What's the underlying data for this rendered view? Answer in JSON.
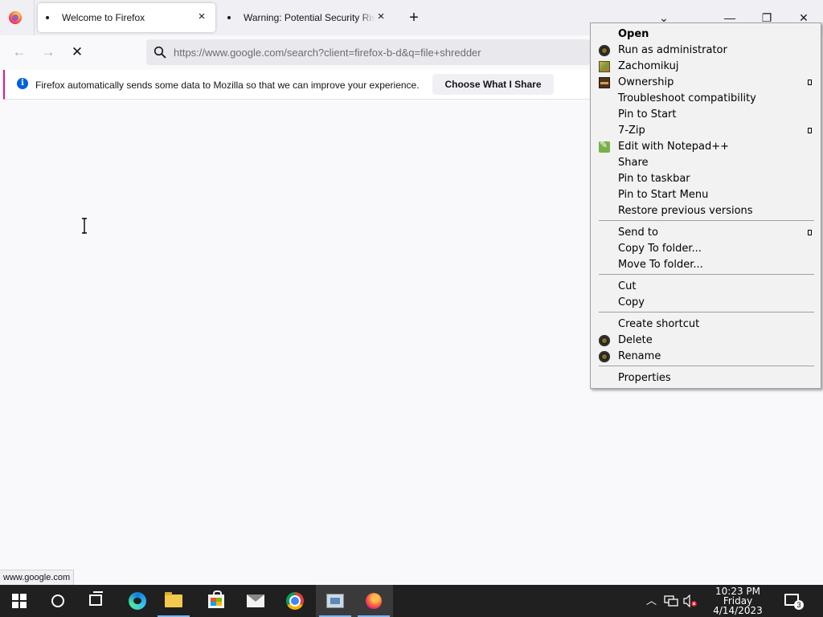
{
  "tabs": [
    {
      "title": "Welcome to Firefox",
      "close": "×"
    },
    {
      "title": "Warning: Potential Security Risk Ahead",
      "close": "×"
    }
  ],
  "window_controls": {
    "list_all_tabs": "⌄",
    "minimize": "—",
    "restore": "❐",
    "close": "✕"
  },
  "nav": {
    "back": "←",
    "forward": "→",
    "stop": "✕",
    "url": "https://www.google.com/search?client=firefox-b-d&q=file+shredder"
  },
  "notification": {
    "text": "Firefox automatically sends some data to Mozilla so that we can improve your experience.",
    "button": "Choose What I Share"
  },
  "status_link": "www.google.com",
  "context_menu": {
    "items": [
      {
        "label": "Open",
        "icon": ""
      },
      {
        "label": "Run as administrator",
        "icon": "shield-gear-icon"
      },
      {
        "label": "Zachomikuj",
        "icon": "zachomikuj-icon"
      },
      {
        "label": "Ownership",
        "icon": "ownership-icon",
        "submenu": true
      },
      {
        "label": "Troubleshoot compatibility",
        "icon": ""
      },
      {
        "label": "Pin to Start",
        "icon": ""
      },
      {
        "label": "7-Zip",
        "icon": "",
        "submenu": true
      },
      {
        "label": "Edit with Notepad++",
        "icon": "notepadpp-icon"
      },
      {
        "label": "Share",
        "icon": ""
      },
      {
        "label": "Pin to taskbar",
        "icon": ""
      },
      {
        "label": "Pin to Start Menu",
        "icon": ""
      },
      {
        "label": "Restore previous versions",
        "icon": ""
      },
      {
        "label": "Send to",
        "icon": "",
        "submenu": true
      },
      {
        "label": "Copy To folder...",
        "icon": ""
      },
      {
        "label": "Move To folder...",
        "icon": ""
      },
      {
        "label": "Cut",
        "icon": ""
      },
      {
        "label": "Copy",
        "icon": ""
      },
      {
        "label": "Create shortcut",
        "icon": ""
      },
      {
        "label": "Delete",
        "icon": "gear-icon"
      },
      {
        "label": "Rename",
        "icon": "gear-icon"
      },
      {
        "label": "Properties",
        "icon": ""
      }
    ]
  },
  "taskbar": {
    "apps": [
      "start",
      "search",
      "task-view",
      "edge",
      "file-explorer",
      "microsoft-store",
      "mail",
      "chrome",
      "control-panel",
      "firefox"
    ],
    "clock": {
      "time": "10:23 PM",
      "day": "Friday",
      "date": "4/14/2023"
    },
    "notification_count": "3"
  },
  "colors": {
    "accent": "#0060df",
    "notification_border": "#e31587",
    "taskbar": "#202020"
  }
}
